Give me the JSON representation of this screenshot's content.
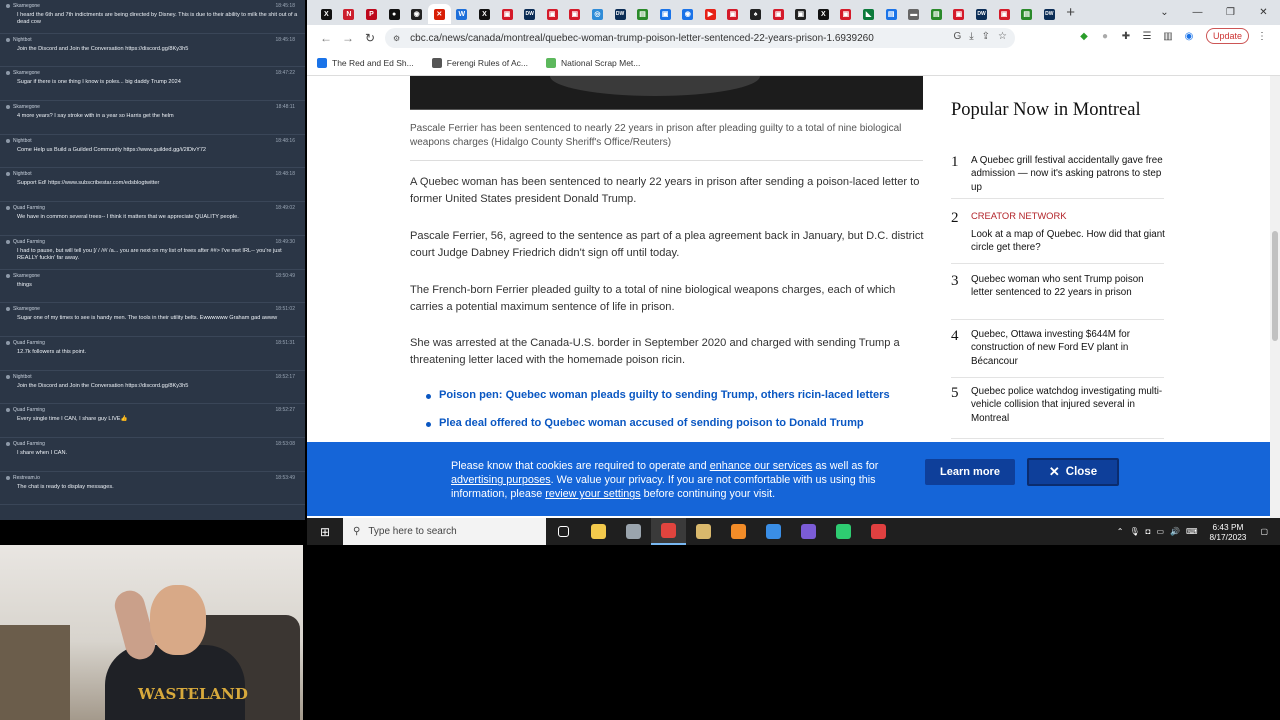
{
  "chat": {
    "messages": [
      {
        "user": "Skarnegone",
        "time": "18:45:18",
        "text": "I heard the 6th and 7th indictments are being directed by Disney. This is due to their ability to milk the shit out of a dead cow"
      },
      {
        "user": "Nightbot",
        "time": "18:45:18",
        "text": "Join the Discord and Join the Conversation https://discord.gg/8Ky3h5"
      },
      {
        "user": "Skarnegone",
        "time": "18:47:22",
        "text": "Sugar if there is one thing I know is poles... big daddy Trump 2024"
      },
      {
        "user": "Skarnegone",
        "time": "18:48:11",
        "text": "4 more years? I say stroke with in a year so Harris get the helm"
      },
      {
        "user": "Nightbot",
        "time": "18:48:16",
        "text": "Come Help us Build a Guilded Community https://www.guilded.gg/i/2lDivY72"
      },
      {
        "user": "Nightbot",
        "time": "18:48:18",
        "text": "Support Ed! https://www.subscribestar.com/edsblogtwitter"
      },
      {
        "user": "Quad Farming",
        "time": "18:49:02",
        "text": "We have in common several trees-- I think it matters that we appreciate QUALITY people."
      },
      {
        "user": "Quad Farming",
        "time": "18:49:30",
        "text": "I had to pause, but will tell you [/ / /#/ /a... you are next on my list of trees after ##> I've met IRL-- you're just REALLY fuckin' far away."
      },
      {
        "user": "Skarnegone",
        "time": "18:50:49",
        "text": "things"
      },
      {
        "user": "Skarnegone",
        "time": "18:51:02",
        "text": "Sugar one of my times to see is handy men. The tools in their utility belts. Ewwwwww Graham gad awww"
      },
      {
        "user": "Quad Farming",
        "time": "18:51:31",
        "text": "12.7k followers at this point."
      },
      {
        "user": "Nightbot",
        "time": "18:52:17",
        "text": "Join the Discord and Join the Conversation https://discord.gg/8Ky3h5"
      },
      {
        "user": "Quad Farming",
        "time": "18:52:27",
        "text": "Every single time I CAN, I share guy LIVE👍"
      },
      {
        "user": "Quad Farming",
        "time": "18:53:08",
        "text": "I share when I CAN."
      },
      {
        "user": "Restream.io",
        "time": "18:53:49",
        "text": "The chat is ready to display messages."
      }
    ]
  },
  "webcam": {
    "shirt_text": "WASTELAND"
  },
  "browser": {
    "tabs": [
      {
        "icon": "x-icon",
        "color": "#111111",
        "glyph": "X"
      },
      {
        "icon": "news-icon",
        "color": "#cc1f2d",
        "glyph": "N"
      },
      {
        "icon": "p-icon",
        "color": "#bd081c",
        "glyph": "P"
      },
      {
        "icon": "news-icon",
        "color": "#111111",
        "glyph": "●"
      },
      {
        "icon": "news-icon",
        "color": "#222222",
        "glyph": "◉"
      },
      {
        "icon": "cbc-icon",
        "color": "#d81e05",
        "glyph": "✕"
      },
      {
        "icon": "news-icon",
        "color": "#1e6fd9",
        "glyph": "W"
      },
      {
        "icon": "x-icon",
        "color": "#111111",
        "glyph": "X"
      },
      {
        "icon": "news-icon",
        "color": "#d41a2a",
        "glyph": "▣"
      },
      {
        "icon": "dw-icon",
        "color": "#0b2d56",
        "glyph": "DW"
      },
      {
        "icon": "news-icon",
        "color": "#d41a2a",
        "glyph": "▣"
      },
      {
        "icon": "news-icon",
        "color": "#d41a2a",
        "glyph": "▣"
      },
      {
        "icon": "news-icon",
        "color": "#2f8cd8",
        "glyph": "◎"
      },
      {
        "icon": "dw-icon",
        "color": "#0b2d56",
        "glyph": "DW"
      },
      {
        "icon": "news-icon",
        "color": "#2a8a2a",
        "glyph": "▤"
      },
      {
        "icon": "news-icon",
        "color": "#1a73e8",
        "glyph": "▣"
      },
      {
        "icon": "news-icon",
        "color": "#1a73e8",
        "glyph": "◉"
      },
      {
        "icon": "youtube-icon",
        "color": "#e62117",
        "glyph": "▶"
      },
      {
        "icon": "news-icon",
        "color": "#d41a2a",
        "glyph": "▣"
      },
      {
        "icon": "news-icon",
        "color": "#222222",
        "glyph": "♠"
      },
      {
        "icon": "news-icon",
        "color": "#d41a2a",
        "glyph": "▣"
      },
      {
        "icon": "news-icon",
        "color": "#222222",
        "glyph": "▣"
      },
      {
        "icon": "x-icon",
        "color": "#111111",
        "glyph": "X"
      },
      {
        "icon": "news-icon",
        "color": "#d41a2a",
        "glyph": "▣"
      },
      {
        "icon": "news-icon",
        "color": "#0b7a3b",
        "glyph": "◣"
      },
      {
        "icon": "news-icon",
        "color": "#1a73e8",
        "glyph": "▤"
      },
      {
        "icon": "news-icon",
        "color": "#666666",
        "glyph": "▬"
      },
      {
        "icon": "news-icon",
        "color": "#2a8a2a",
        "glyph": "▤"
      },
      {
        "icon": "news-icon",
        "color": "#d41a2a",
        "glyph": "▣"
      },
      {
        "icon": "dw-icon",
        "color": "#0b2d56",
        "glyph": "DW"
      },
      {
        "icon": "news-icon",
        "color": "#d41a2a",
        "glyph": "▣"
      },
      {
        "icon": "news-icon",
        "color": "#2a8a2a",
        "glyph": "▤"
      },
      {
        "icon": "dw-icon",
        "color": "#0b2d56",
        "glyph": "DW"
      }
    ],
    "url": "cbc.ca/news/canada/montreal/quebec-woman-trump-poison-letter-sentenced-22-years-prison-1.6939260",
    "update_label": "Update",
    "bookmarks": [
      {
        "label": "The Red and Ed Sh...",
        "color": "#1a73e8"
      },
      {
        "label": "Ferengi Rules of Ac...",
        "color": "#555555"
      },
      {
        "label": "National Scrap Met...",
        "color": "#5cb85c"
      }
    ]
  },
  "article": {
    "caption": "Pascale Ferrier has been sentenced to nearly 22 years in prison after pleading guilty to a total of nine biological weapons charges (Hidalgo County Sheriff's Office/Reuters)",
    "paragraphs": [
      "A Quebec woman has been sentenced to nearly 22 years in prison after sending a poison-laced letter to former United States president Donald Trump.",
      "Pascale Ferrier, 56, agreed to the sentence as part of a plea agreement back in January, but D.C. district court Judge Dabney Friedrich didn't sign off until today.",
      "The French-born Ferrier pleaded guilty to a total of nine biological weapons charges, each of which carries a potential maximum sentence of life in prison.",
      "She was arrested at the Canada-U.S. border in September 2020 and charged with sending Trump a threatening letter laced with the homemade poison ricin."
    ],
    "related": [
      "Poison pen: Quebec woman pleads guilty to sending Trump, others ricin-laced letters",
      "Plea deal offered to Quebec woman accused of sending poison to Donald Trump"
    ]
  },
  "sidebar": {
    "title": "Popular Now in Montreal",
    "items": [
      {
        "num": "1",
        "tag": "",
        "text": "A Quebec grill festival accidentally gave free admission — now it's asking patrons to step up"
      },
      {
        "num": "2",
        "tag": "CREATOR NETWORK",
        "text": "Look at a map of Quebec. How did that giant circle get there?"
      },
      {
        "num": "3",
        "tag": "",
        "text": "Quebec woman who sent Trump poison letter sentenced to 22 years in prison"
      },
      {
        "num": "4",
        "tag": "",
        "text": "Quebec, Ottawa investing $644M for construction of new Ford EV plant in Bécancour"
      },
      {
        "num": "5",
        "tag": "",
        "text": "Quebec police watchdog investigating multi-vehicle collision that injured several in Montreal"
      }
    ]
  },
  "cookie": {
    "t1": "Please know that cookies are required to operate and ",
    "l1": "enhance our services",
    "t2": " as well as for ",
    "l2": "advertising purposes",
    "t3": ". We value your privacy. If you are not comfortable with us using this information, please ",
    "l3": "review your settings",
    "t4": " before continuing your visit.",
    "learn_more": "Learn more",
    "close": "Close"
  },
  "taskbar": {
    "search_placeholder": "Type here to search",
    "time": "6:43 PM",
    "date": "8/17/2023",
    "apps": [
      {
        "name": "task-view-icon",
        "color": "#ffffff"
      },
      {
        "name": "file-explorer-icon",
        "color": "#f2c94c"
      },
      {
        "name": "app-icon",
        "color": "#9aa4ad"
      },
      {
        "name": "chrome-icon",
        "color": "#e0443e"
      },
      {
        "name": "app-icon",
        "color": "#d9b86c"
      },
      {
        "name": "app-icon",
        "color": "#f28c28"
      },
      {
        "name": "app-icon",
        "color": "#3a8ee6"
      },
      {
        "name": "app-icon",
        "color": "#7b5cd6"
      },
      {
        "name": "app-icon",
        "color": "#2ecc71"
      },
      {
        "name": "app-icon",
        "color": "#e04040"
      }
    ]
  }
}
